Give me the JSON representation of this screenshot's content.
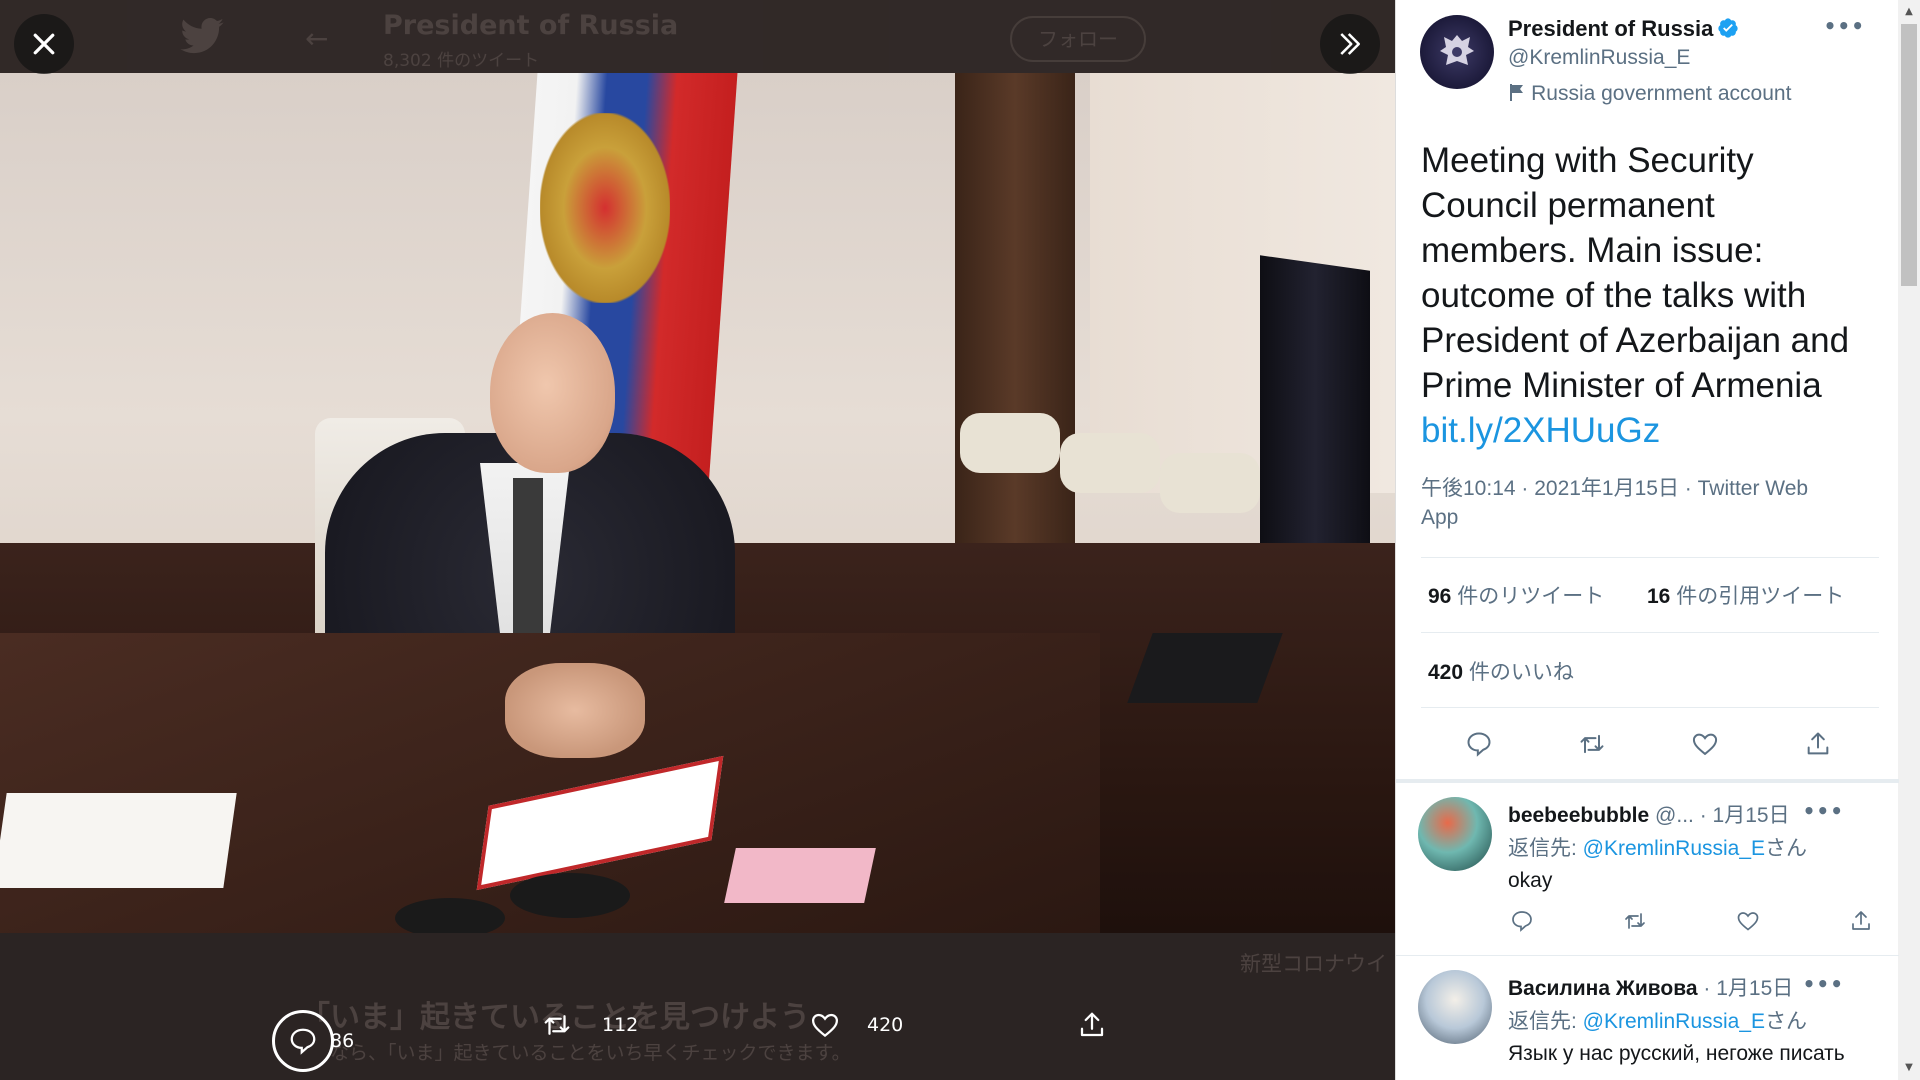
{
  "background_page": {
    "title": "President of Russia",
    "tweet_count": "8,302 件のツイート",
    "follow_label": "フォロー",
    "trend_text": "新型コロナウイ",
    "cta_title": "「いま」起きていることを見つけよう",
    "cta_subtitle": "なら、「いま」起きていることをいち早くチェックできます。"
  },
  "media_actions": {
    "reply_count": "86",
    "retweet_count": "112",
    "like_count": "420"
  },
  "tweet": {
    "author_name": "President of Russia",
    "author_handle": "@KremlinRussia_E",
    "account_label": "Russia government account",
    "text": "Meeting with Security Council permanent members. Main issue: outcome of the talks with President of Azerbaijan and Prime Minister of Armenia",
    "link": "bit.ly/2XHUuGz",
    "timestamp_line1": "午後10:14 · 2021年1月15日 · Twitter Web",
    "timestamp_line2": "App",
    "retweets_num": "96",
    "retweets_label": "件のリツイート",
    "quotes_num": "16",
    "quotes_label": "件の引用ツイート",
    "likes_num": "420",
    "likes_label": "件のいいね",
    "more_label": "•••"
  },
  "replies": [
    {
      "name": "beebeebubble",
      "handle": "@...",
      "date": "· 1月15日",
      "reply_to_prefix": "返信先: ",
      "reply_to_handle": "@KremlinRussia_E",
      "reply_to_suffix": "さん",
      "text": "okay"
    },
    {
      "name": "Василина Живова",
      "handle": "",
      "date": "· 1月15日",
      "reply_to_prefix": "返信先: ",
      "reply_to_handle": "@KremlinRussia_E",
      "reply_to_suffix": "さん",
      "text": "Язык у нас русский, негоже писать"
    }
  ],
  "colors": {
    "accent": "#1b95e0",
    "verified": "#1da1f2",
    "text_primary": "#14171a",
    "text_secondary": "#5b7083",
    "viewer_bg": "#2b2423"
  },
  "icons": {
    "close": "close-icon",
    "expand": "double-chevron-right-icon",
    "reply": "speech-bubble-icon",
    "retweet": "retweet-arrows-icon",
    "like": "heart-icon",
    "share": "share-upload-icon",
    "flag": "flag-icon",
    "verified": "verified-badge-icon"
  }
}
